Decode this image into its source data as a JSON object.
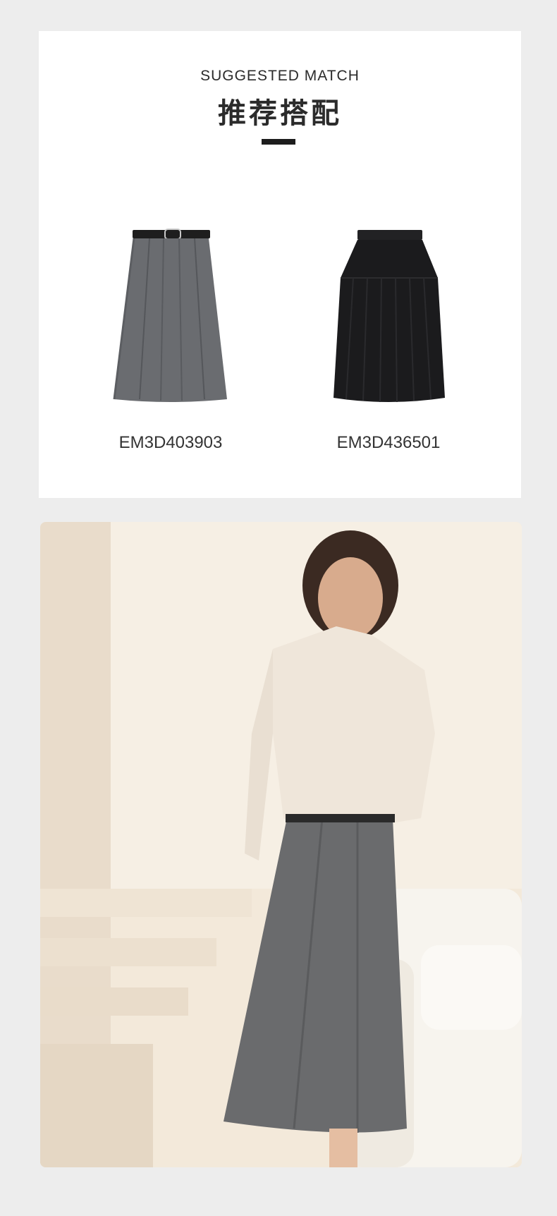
{
  "match_section": {
    "eyebrow": "SUGGESTED MATCH",
    "headline": "推荐搭配",
    "products": [
      {
        "code": "EM3D403903",
        "image": "grey-pleated-midi-skirt-with-belt",
        "color": "#6a6c70"
      },
      {
        "code": "EM3D436501",
        "image": "black-pleated-midi-skirt",
        "color": "#1b1b1d"
      }
    ]
  },
  "lifestyle_photo": {
    "image": "model-in-cream-satin-shirt-and-grey-pleated-skirt",
    "colors": {
      "wall": "#f3e9da",
      "shirt": "#efe6da",
      "skirt": "#6a6b6d",
      "sofa": "#f7f4ee"
    }
  }
}
